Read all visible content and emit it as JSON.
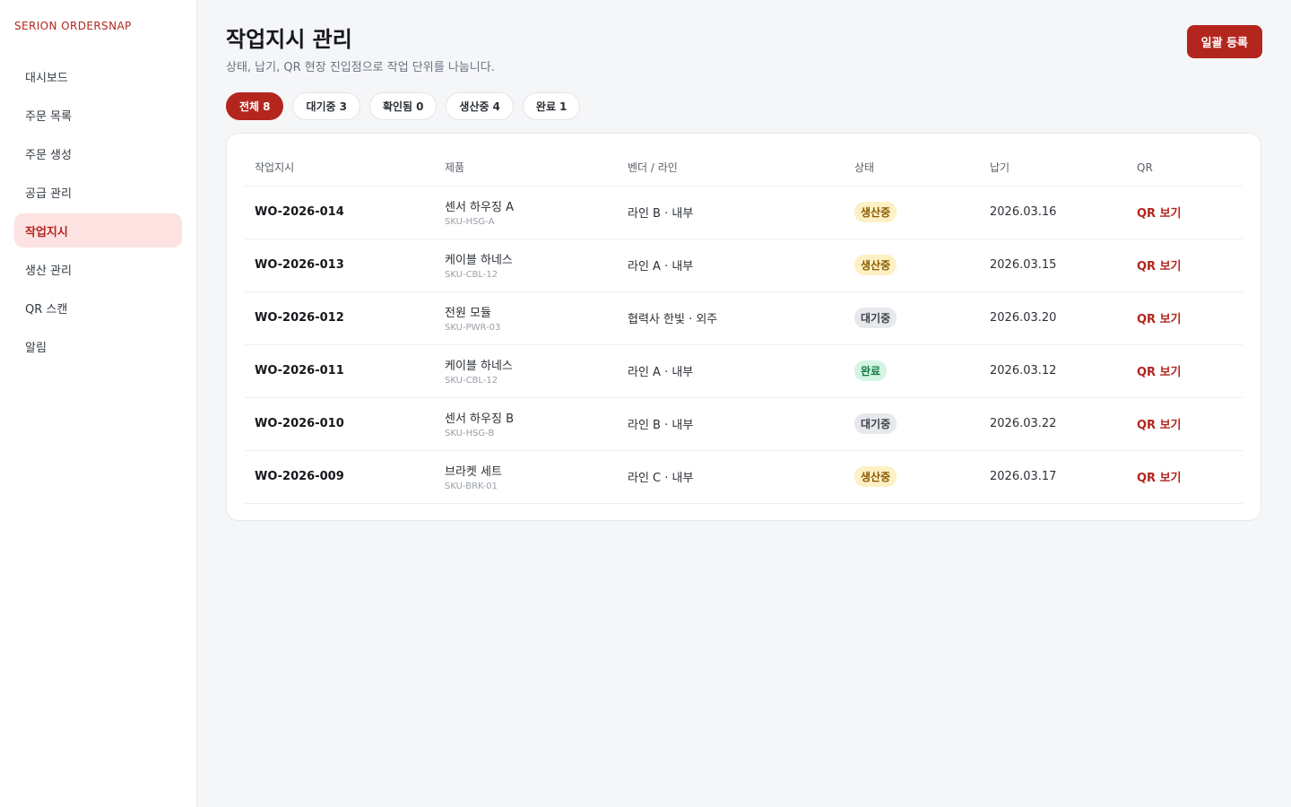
{
  "sidebar": {
    "brand": "SERION ORDERSNAP",
    "items": [
      {
        "label": "대시보드",
        "active": false
      },
      {
        "label": "주문 목록",
        "active": false
      },
      {
        "label": "주문 생성",
        "active": false
      },
      {
        "label": "공급 관리",
        "active": false
      },
      {
        "label": "작업지시",
        "active": true
      },
      {
        "label": "생산 관리",
        "active": false
      },
      {
        "label": "QR 스캔",
        "active": false
      },
      {
        "label": "알림",
        "active": false
      }
    ]
  },
  "header": {
    "title": "작업지시 관리",
    "subtitle": "상태, 납기, QR 현장 진입점으로 작업 단위를 나눕니다.",
    "bulk_button": "일괄 등록"
  },
  "filters": [
    {
      "label": "전체",
      "count": "8",
      "active": true
    },
    {
      "label": "대기중",
      "count": "3",
      "active": false
    },
    {
      "label": "확인됨",
      "count": "0",
      "active": false
    },
    {
      "label": "생산중",
      "count": "4",
      "active": false
    },
    {
      "label": "완료",
      "count": "1",
      "active": false
    }
  ],
  "table": {
    "columns": [
      "작업지시",
      "제품",
      "벤더 / 라인",
      "상태",
      "납기",
      "QR"
    ],
    "rows": [
      {
        "id": "WO-2026-014",
        "product": "센서 하우징 A",
        "sku": "SKU-HSG-A",
        "vendor": "라인 B · 내부",
        "status": "생산중",
        "status_kind": "producing",
        "due": "2026.03.16",
        "qr": "QR 보기"
      },
      {
        "id": "WO-2026-013",
        "product": "케이블 하네스",
        "sku": "SKU-CBL-12",
        "vendor": "라인 A · 내부",
        "status": "생산중",
        "status_kind": "producing",
        "due": "2026.03.15",
        "qr": "QR 보기"
      },
      {
        "id": "WO-2026-012",
        "product": "전원 모듈",
        "sku": "SKU-PWR-03",
        "vendor": "협력사 한빛 · 외주",
        "status": "대기중",
        "status_kind": "waiting",
        "due": "2026.03.20",
        "qr": "QR 보기"
      },
      {
        "id": "WO-2026-011",
        "product": "케이블 하네스",
        "sku": "SKU-CBL-12",
        "vendor": "라인 A · 내부",
        "status": "완료",
        "status_kind": "done",
        "due": "2026.03.12",
        "qr": "QR 보기"
      },
      {
        "id": "WO-2026-010",
        "product": "센서 하우징 B",
        "sku": "SKU-HSG-B",
        "vendor": "라인 B · 내부",
        "status": "대기중",
        "status_kind": "waiting",
        "due": "2026.03.22",
        "qr": "QR 보기"
      },
      {
        "id": "WO-2026-009",
        "product": "브라켓 세트",
        "sku": "SKU-BRK-01",
        "vendor": "라인 C · 내부",
        "status": "생산중",
        "status_kind": "producing",
        "due": "2026.03.17",
        "qr": "QR 보기"
      }
    ]
  },
  "colors": {
    "accent": "#b3261e",
    "active_nav_bg": "#fde2e2",
    "producing_bg": "#fdf0c4",
    "waiting_bg": "#e6e8ec",
    "done_bg": "#d4f5e3"
  }
}
